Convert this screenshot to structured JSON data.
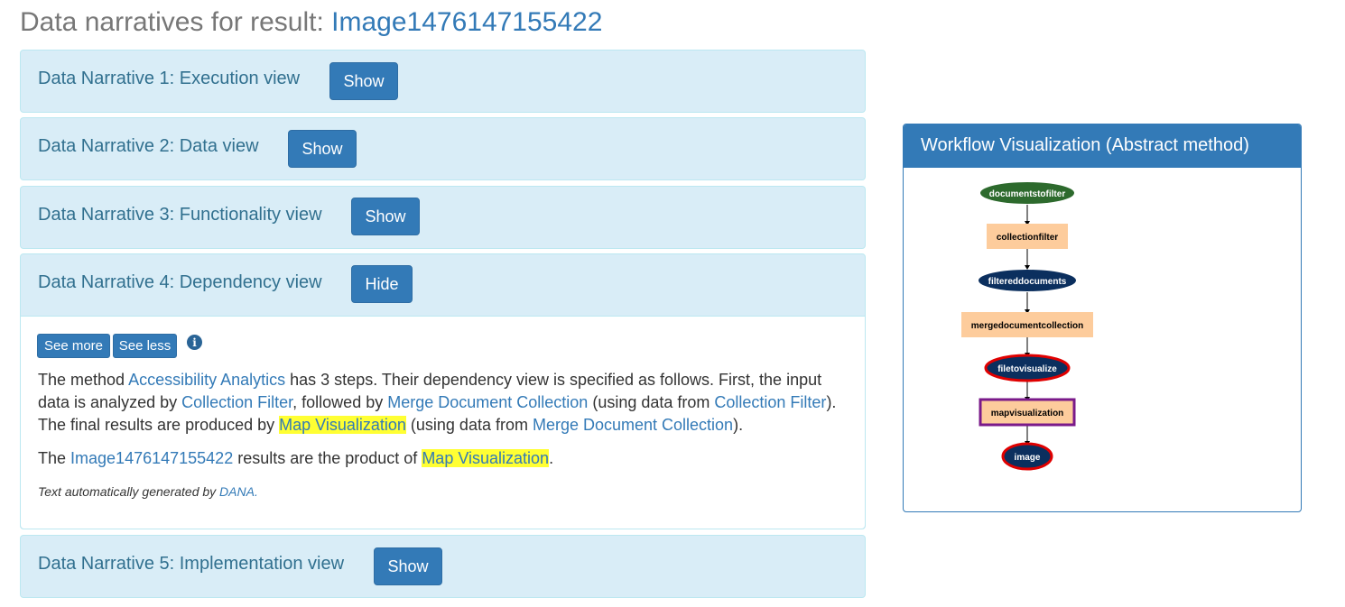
{
  "page": {
    "title_prefix": "Data narratives for result:",
    "title_link": "Image1476147155422"
  },
  "narratives": [
    {
      "title": "Data Narrative 1: Execution view",
      "button": "Show"
    },
    {
      "title": "Data Narrative 2: Data view",
      "button": "Show"
    },
    {
      "title": "Data Narrative 3: Functionality view",
      "button": "Show"
    },
    {
      "title": "Data Narrative 4: Dependency view",
      "button": "Hide"
    },
    {
      "title": "Data Narrative 5: Implementation view",
      "button": "Show"
    }
  ],
  "expanded": {
    "see_more": "See more",
    "see_less": "See less",
    "info_icon": "i",
    "p1": {
      "t1": "The method ",
      "l1": "Accessibility Analytics",
      "t2": " has 3 steps. Their dependency view is specified as follows. First, the input data is analyzed by ",
      "l2": "Collection Filter",
      "t3": ", followed by ",
      "l3": "Merge Document Collection",
      "t4": " (using data from ",
      "l4": "Collection Filter",
      "t5": "). The final results are produced by ",
      "l5": "Map Visualization",
      "t6": " (using data from ",
      "l6": "Merge Document Collection",
      "t7": ")."
    },
    "p2": {
      "t1": "The ",
      "l1": "Image1476147155422",
      "t2": " results are the product of ",
      "l2": "Map Visualization",
      "t3": "."
    },
    "footnote": {
      "text": "Text automatically generated by ",
      "link": "DANA."
    }
  },
  "workflow": {
    "title": "Workflow Visualization (Abstract method)",
    "nodes": [
      {
        "label": "documentstofilter",
        "kind": "input"
      },
      {
        "label": "collectionfilter",
        "kind": "step"
      },
      {
        "label": "filtereddocuments",
        "kind": "data"
      },
      {
        "label": "mergedocumentcollection",
        "kind": "step"
      },
      {
        "label": "filetovisualize",
        "kind": "data-highlight"
      },
      {
        "label": "mapvisualization",
        "kind": "step-highlight"
      },
      {
        "label": "image",
        "kind": "data-highlight"
      }
    ],
    "colors": {
      "input": "#2d6a2d",
      "data": "#0b2f5e",
      "step": "#fdcc9c",
      "highlight_red": "#e00000",
      "highlight_purple": "#7a1a8a",
      "accent": "#337ab7",
      "panel_bg": "#d9edf7",
      "panel_text": "#31708f",
      "text_highlight": "#ffff33"
    }
  }
}
